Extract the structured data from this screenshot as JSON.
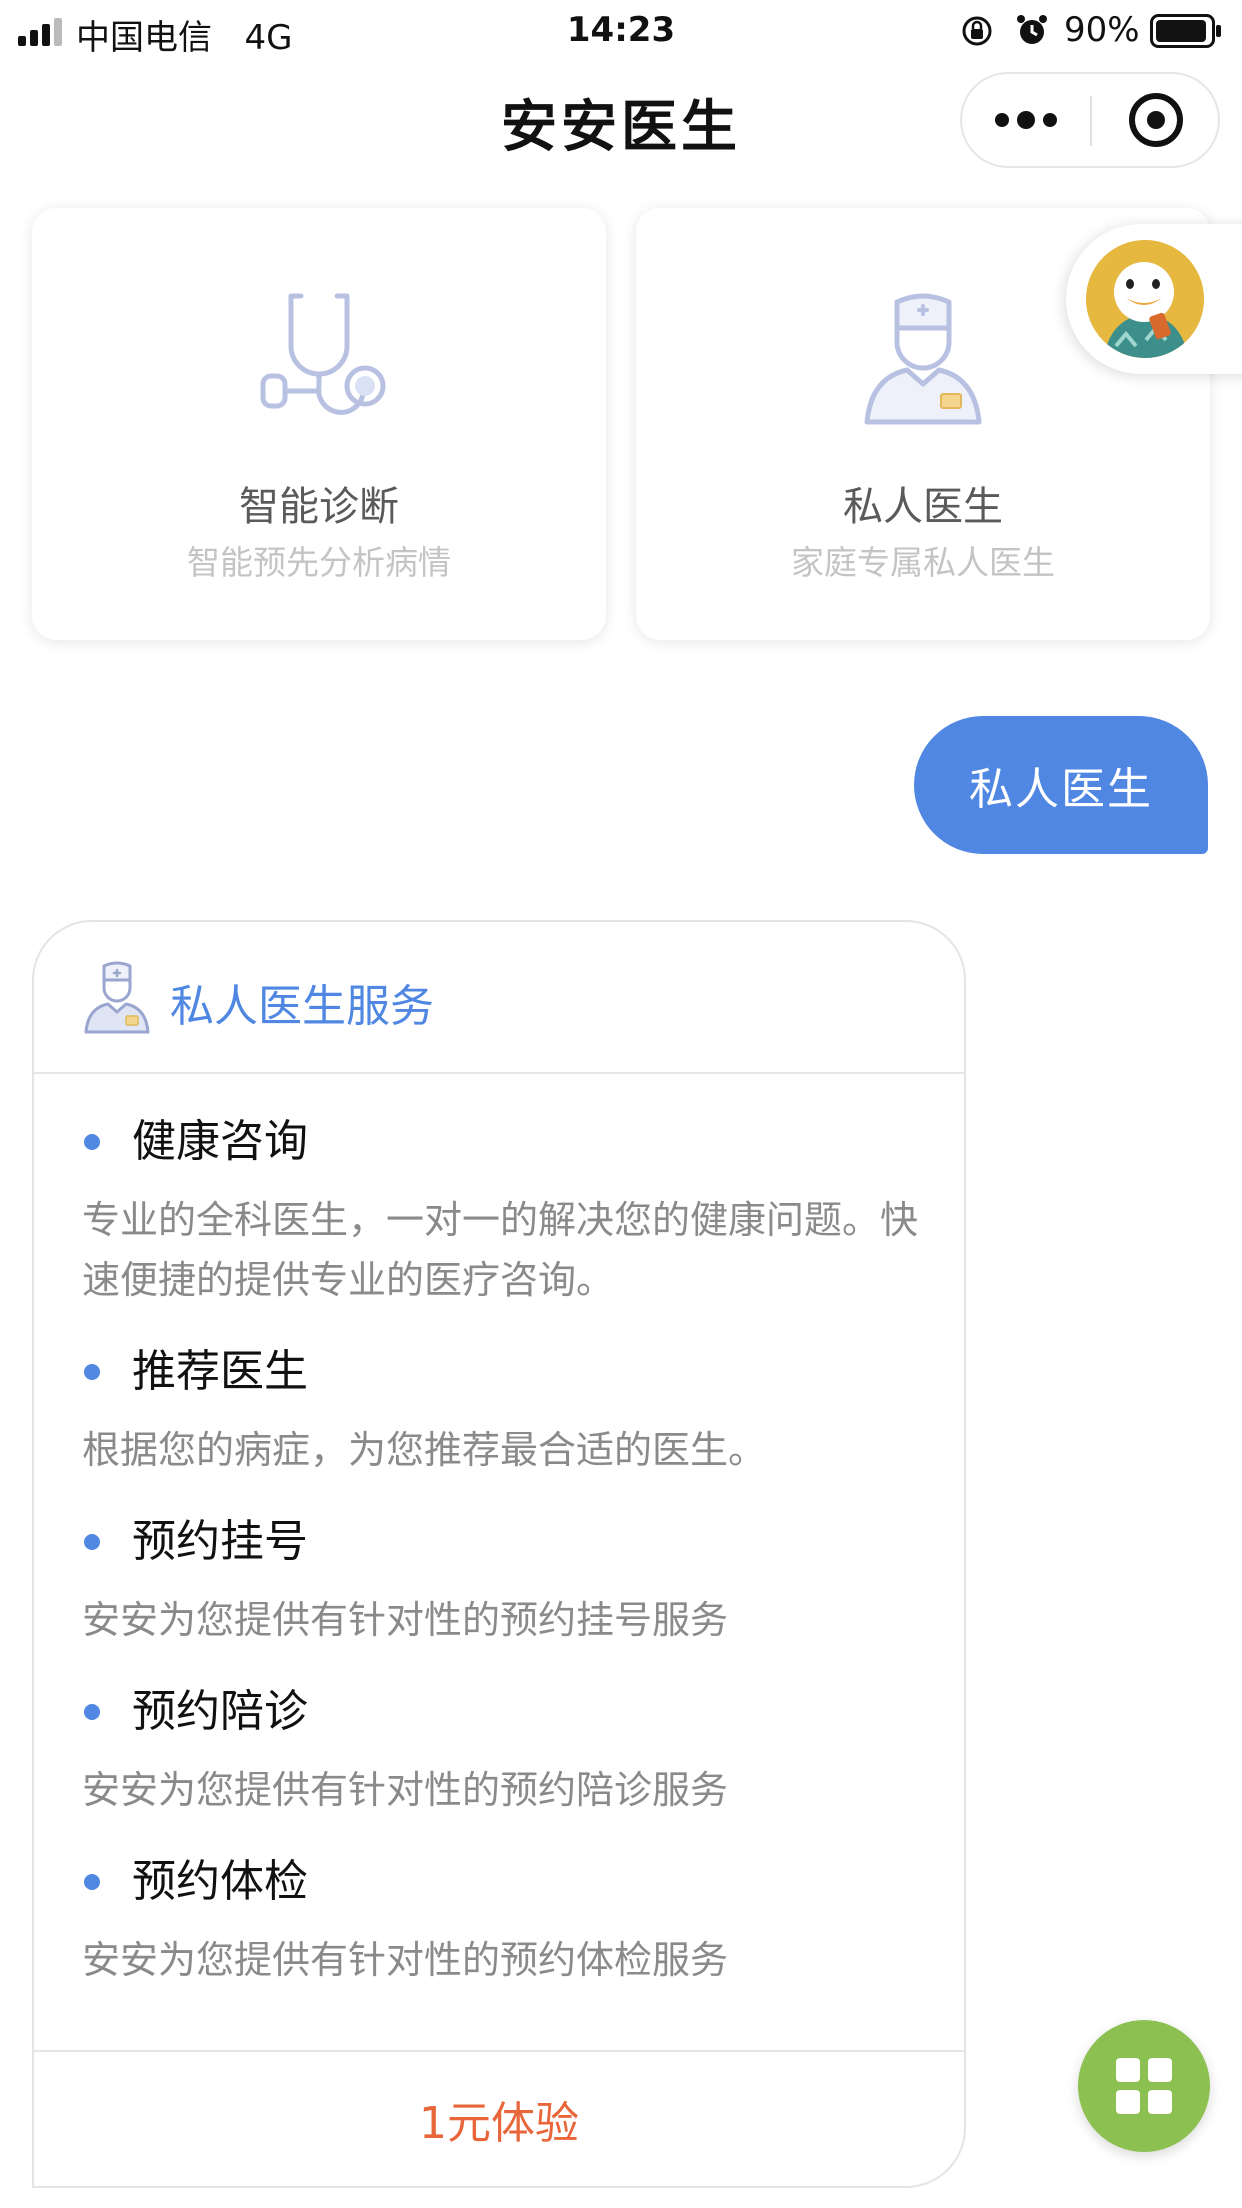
{
  "status_bar": {
    "carrier": "中国电信",
    "network": "4G",
    "time": "14:23",
    "battery": "90%"
  },
  "nav": {
    "title": "安安医生"
  },
  "feature_cards": [
    {
      "title": "智能诊断",
      "subtitle": "智能预先分析病情",
      "icon": "stethoscope-icon"
    },
    {
      "title": "私人医生",
      "subtitle": "家庭专属私人医生",
      "icon": "doctor-icon"
    }
  ],
  "chat": {
    "user_message": "私人医生"
  },
  "service_card": {
    "title": "私人医生服务",
    "items": [
      {
        "title": "健康咨询",
        "desc": "专业的全科医生，一对一的解决您的健康问题。快速便捷的提供专业的医疗咨询。"
      },
      {
        "title": "推荐医生",
        "desc": "根据您的病症，为您推荐最合适的医生。"
      },
      {
        "title": "预约挂号",
        "desc": "安安为您提供有针对性的预约挂号服务"
      },
      {
        "title": "预约陪诊",
        "desc": "安安为您提供有针对性的预约陪诊服务"
      },
      {
        "title": "预约体检",
        "desc": "安安为您提供有针对性的预约体检服务"
      }
    ],
    "cta": "1元体验"
  },
  "colors": {
    "accent": "#4f87e3",
    "cta": "#e8663a",
    "fab": "#8cc152"
  }
}
